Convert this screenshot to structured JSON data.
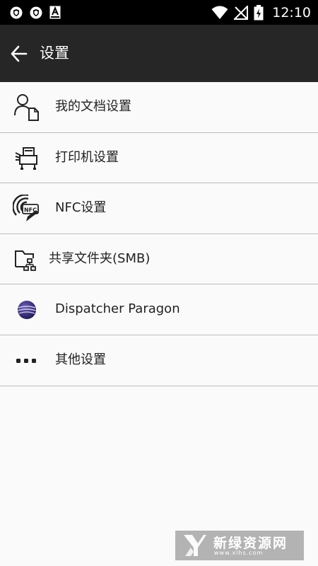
{
  "status_bar": {
    "time": "12:10",
    "left_icons": [
      "shield-icon",
      "shield-icon",
      "text-a-icon"
    ],
    "right_icons": [
      "wifi-icon",
      "no-signal-icon",
      "battery-charging-icon"
    ]
  },
  "app_bar": {
    "back_icon": "arrow-back-icon",
    "title": "设置"
  },
  "settings": {
    "items": [
      {
        "label": "我的文档设置",
        "icon": "user-document-icon"
      },
      {
        "label": "打印机设置",
        "icon": "printer-icon"
      },
      {
        "label": "NFC设置",
        "icon": "nfc-icon"
      },
      {
        "label": "共享文件夹(SMB)",
        "icon": "shared-folder-icon"
      },
      {
        "label": "Dispatcher Paragon",
        "icon": "dispatcher-paragon-logo-icon"
      },
      {
        "label": "其他设置",
        "icon": "more-dots-icon"
      }
    ]
  },
  "watermark": {
    "text": "新绿资源网",
    "url": "www.xlhs.com"
  },
  "colors": {
    "status_bar": "#000000",
    "app_bar": "#262626",
    "background": "#fafafa",
    "divider": "#bdbdbd"
  }
}
